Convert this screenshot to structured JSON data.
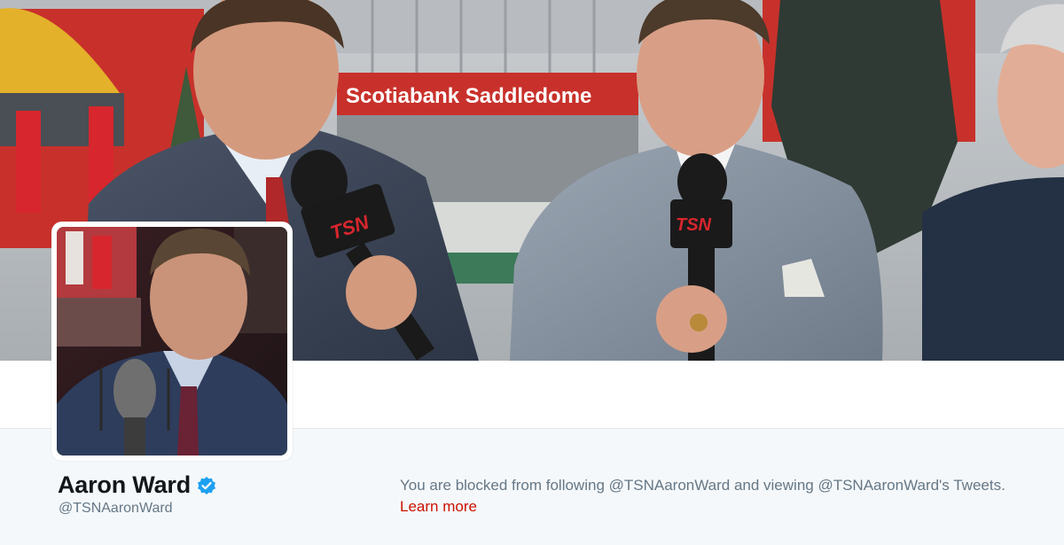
{
  "header": {
    "banner_sign_text": "Scotiabank Saddledome",
    "mic_logo_text": "TSN"
  },
  "profile": {
    "display_name": "Aaron Ward",
    "handle": "@TSNAaronWard",
    "verified": true
  },
  "blocked_notice": {
    "message": "You are blocked from following @TSNAaronWard and viewing @TSNAaronWard's Tweets.",
    "link_label": "Learn more"
  },
  "colors": {
    "background": "#f5f8fa",
    "verified_blue": "#1da1f2",
    "link_red": "#cc1100",
    "secondary_text": "#657786",
    "name_text": "#14171a"
  }
}
